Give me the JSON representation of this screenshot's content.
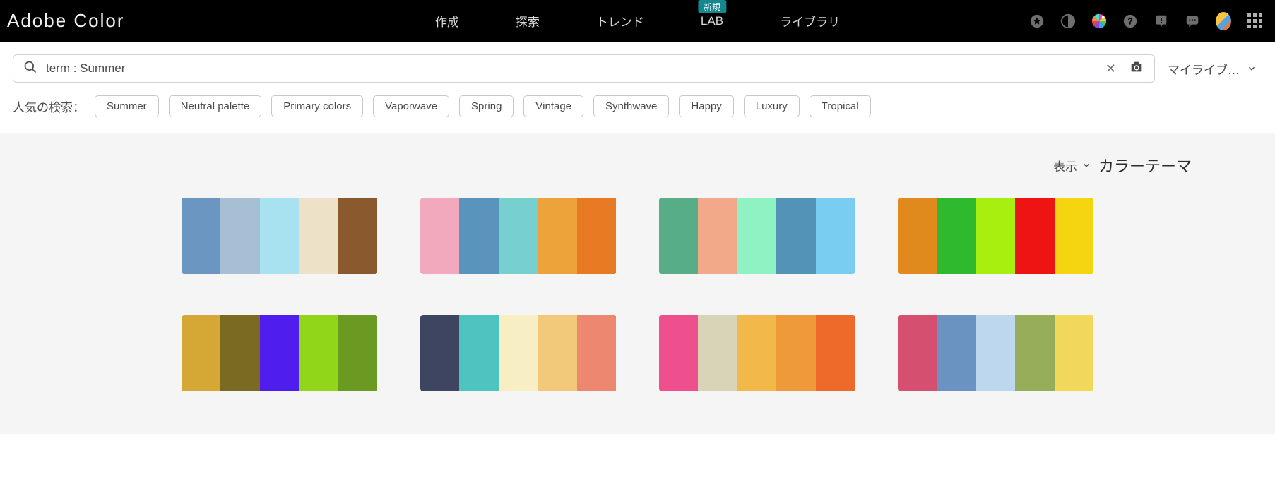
{
  "header": {
    "logo": "Adobe Color",
    "nav": [
      {
        "label": "作成",
        "badge": null
      },
      {
        "label": "探索",
        "badge": null
      },
      {
        "label": "トレンド",
        "badge": null
      },
      {
        "label": "LAB",
        "badge": "新規"
      },
      {
        "label": "ライブラリ",
        "badge": null
      }
    ]
  },
  "search": {
    "value": "term : Summer",
    "placeholder": "",
    "mylib_label": "マイライブ…"
  },
  "tags": {
    "label": "人気の検索：",
    "items": [
      "Summer",
      "Neutral palette",
      "Primary colors",
      "Vaporwave",
      "Spring",
      "Vintage",
      "Synthwave",
      "Happy",
      "Luxury",
      "Tropical"
    ]
  },
  "results": {
    "view_label": "表示",
    "title": "カラーテーマ",
    "palettes": [
      [
        "#6a96c1",
        "#a6bfd4",
        "#a8e2f0",
        "#ede1c8",
        "#8a5a2e"
      ],
      [
        "#f2a9bd",
        "#5a93bb",
        "#77d0cf",
        "#eda23a",
        "#e87a24"
      ],
      [
        "#56ad86",
        "#f2a98a",
        "#8ff2c3",
        "#5393b7",
        "#79cdf0"
      ],
      [
        "#e08a1e",
        "#2fb92f",
        "#a8ee0f",
        "#ee1414",
        "#f5d50f"
      ],
      [
        "#d5a734",
        "#7a6a22",
        "#4f1ded",
        "#92d61a",
        "#6a9a22"
      ],
      [
        "#3e4560",
        "#4ec4c1",
        "#f7eec4",
        "#f2c87a",
        "#ee8770"
      ],
      [
        "#ee4f8d",
        "#d8d4b8",
        "#f2b84a",
        "#ee9a3a",
        "#ee6a2a"
      ],
      [
        "#d54f70",
        "#6a93c1",
        "#bcd7ee",
        "#96ae5a",
        "#f2d85a"
      ]
    ]
  }
}
